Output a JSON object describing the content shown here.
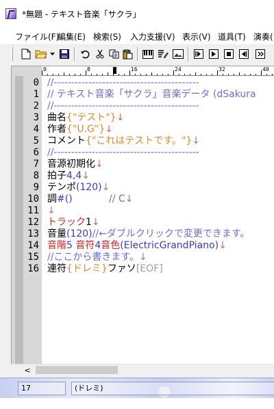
{
  "window": {
    "title": "*無題 - テキスト音楽「サクラ」"
  },
  "menu": {
    "items": [
      "ファイル(F)",
      "編集(E)",
      "検索(S)",
      "入力支援(V)",
      "表示(V)",
      "道具(T)",
      "演奏("
    ]
  },
  "toolbar": {
    "icons": [
      "new-file-icon",
      "open-folder-icon",
      "dropdown-arrow-icon",
      "save-icon",
      "undo-icon",
      "cut-icon",
      "copy-icon",
      "paste-icon",
      "piano-icon",
      "edit-list-icon",
      "picture-icon",
      "play-icon",
      "play-from-cursor-icon",
      "stop-icon",
      "rewind-icon"
    ]
  },
  "ruler": {
    "labels": [
      "0",
      "8",
      "16",
      "24",
      "32",
      "40"
    ]
  },
  "editor": {
    "line_numbers": [
      "0",
      "1",
      "2",
      "3",
      "4",
      "5",
      "6",
      "7",
      "8",
      "9",
      "10",
      "11",
      "12",
      "13",
      "14",
      "15",
      "16"
    ],
    "lines": [
      [
        {
          "t": "//------------------------------------------",
          "c": "#6d6dd8"
        }
      ],
      [
        {
          "t": "// テキスト音楽「サクラ」音楽データ (dSakura",
          "c": "#6d6dd8"
        }
      ],
      [
        {
          "t": "//------------------------------------------",
          "c": "#6d6dd8"
        }
      ],
      [
        {
          "t": "曲名",
          "c": "#000000"
        },
        {
          "t": "{\"テスト\"}",
          "c": "#e08a2a"
        },
        {
          "t": "↓",
          "c": "#c86c6c"
        }
      ],
      [
        {
          "t": "作者",
          "c": "#000000"
        },
        {
          "t": "{\"U.G\"}",
          "c": "#e08a2a"
        },
        {
          "t": "↓",
          "c": "#c86c6c"
        }
      ],
      [
        {
          "t": "コメント",
          "c": "#000000"
        },
        {
          "t": "{\"これはテストです。\"}",
          "c": "#e08a2a"
        },
        {
          "t": "↓",
          "c": "#c86c6c"
        }
      ],
      [
        {
          "t": "//------------------------------------------",
          "c": "#6d6dd8"
        }
      ],
      [
        {
          "t": "音源初期化",
          "c": "#000000"
        },
        {
          "t": "↓",
          "c": "#c86c6c"
        }
      ],
      [
        {
          "t": "拍子",
          "c": "#000000"
        },
        {
          "t": "4,4",
          "c": "#3a3ac8"
        },
        {
          "t": "↓",
          "c": "#c86c6c"
        }
      ],
      [
        {
          "t": "テンポ",
          "c": "#000000"
        },
        {
          "t": "(120)",
          "c": "#3a3ac8"
        },
        {
          "t": "↓",
          "c": "#c86c6c"
        }
      ],
      [
        {
          "t": "調",
          "c": "#000000"
        },
        {
          "t": "#()",
          "c": "#3a3ac8"
        },
        {
          "t": "            // C",
          "c": "#6d6dd8"
        },
        {
          "t": "↓",
          "c": "#c86c6c"
        }
      ],
      [
        {
          "t": "↓",
          "c": "#c86c6c"
        }
      ],
      [
        {
          "t": "トラック",
          "c": "#e02020"
        },
        {
          "t": "1",
          "c": "#000000"
        },
        {
          "t": "↓",
          "c": "#c86c6c"
        }
      ],
      [
        {
          "t": "音量",
          "c": "#000000"
        },
        {
          "t": "(120)",
          "c": "#3a3ac8"
        },
        {
          "t": "//←ダブルクリックで変更できます。",
          "c": "#6d6dd8"
        }
      ],
      [
        {
          "t": "音階",
          "c": "#e02020"
        },
        {
          "t": "5 ",
          "c": "#3a3ac8"
        },
        {
          "t": "音符",
          "c": "#e02020"
        },
        {
          "t": "4",
          "c": "#3a3ac8"
        },
        {
          "t": "音色",
          "c": "#e02020"
        },
        {
          "t": "(ElectricGrandPiano)",
          "c": "#3a3ac8"
        },
        {
          "t": "↓",
          "c": "#c86c6c"
        }
      ],
      [
        {
          "t": "//ここから書きます。",
          "c": "#6d6dd8"
        },
        {
          "t": "↓",
          "c": "#c86c6c"
        }
      ],
      [
        {
          "t": "連符",
          "c": "#000000"
        },
        {
          "t": "{ドレミ}",
          "c": "#e08a2a"
        },
        {
          "t": "ファソ",
          "c": "#000000"
        },
        {
          "t": "[EOF]",
          "c": "#9a9ac0"
        }
      ]
    ]
  },
  "status": {
    "line": "17",
    "info": "(ドレミ)"
  }
}
